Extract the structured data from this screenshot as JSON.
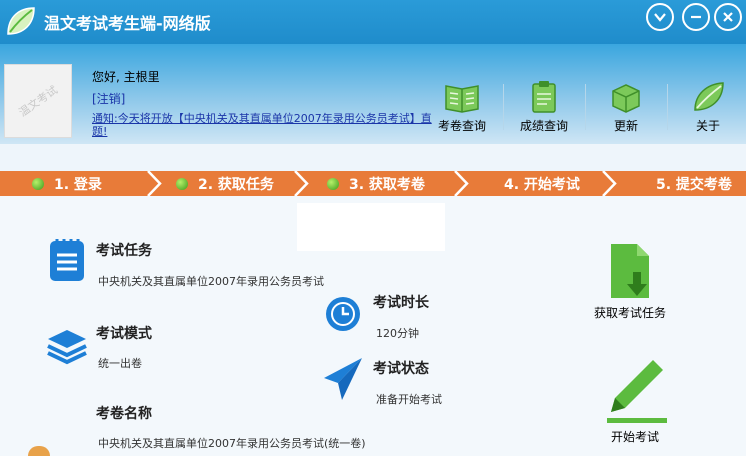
{
  "window": {
    "title": "温文考试考生端-网络版"
  },
  "user": {
    "greeting": "您好, 主根里",
    "logout": "[注销]",
    "notice": "通知:今天将开放【中央机关及其直属单位2007年录用公务员考试】直题!"
  },
  "toolbar": [
    {
      "label": "考卷查询",
      "icon": "book-icon"
    },
    {
      "label": "成绩查询",
      "icon": "clipboard-icon"
    },
    {
      "label": "更新",
      "icon": "box-icon"
    },
    {
      "label": "关于",
      "icon": "leaf-icon"
    }
  ],
  "steps": [
    {
      "label": "1. 登录",
      "done": true
    },
    {
      "label": "2. 获取任务",
      "done": true
    },
    {
      "label": "3. 获取考卷",
      "done": true
    },
    {
      "label": "4. 开始考试",
      "done": false
    },
    {
      "label": "5. 提交考卷",
      "done": false
    }
  ],
  "exam": {
    "task_title": "考试任务",
    "task_value": "中央机关及其直属单位2007年录用公务员考试",
    "mode_title": "考试模式",
    "mode_value": "统一出卷",
    "paper_title": "考卷名称",
    "paper_value": "中央机关及其直属单位2007年录用公务员考试(统一卷)",
    "duration_title": "考试时长",
    "duration_value": "120分钟",
    "status_title": "考试状态",
    "status_value": "准备开始考试"
  },
  "actions": {
    "get_task": "获取考试任务",
    "start_exam": "开始考试"
  },
  "avatar_watermark": "温文考试",
  "colors": {
    "titlebar": "#1f8ccb",
    "stepbar": "#e87b39",
    "accent_blue": "#1e7fd6",
    "accent_green": "#5cbb3f"
  }
}
